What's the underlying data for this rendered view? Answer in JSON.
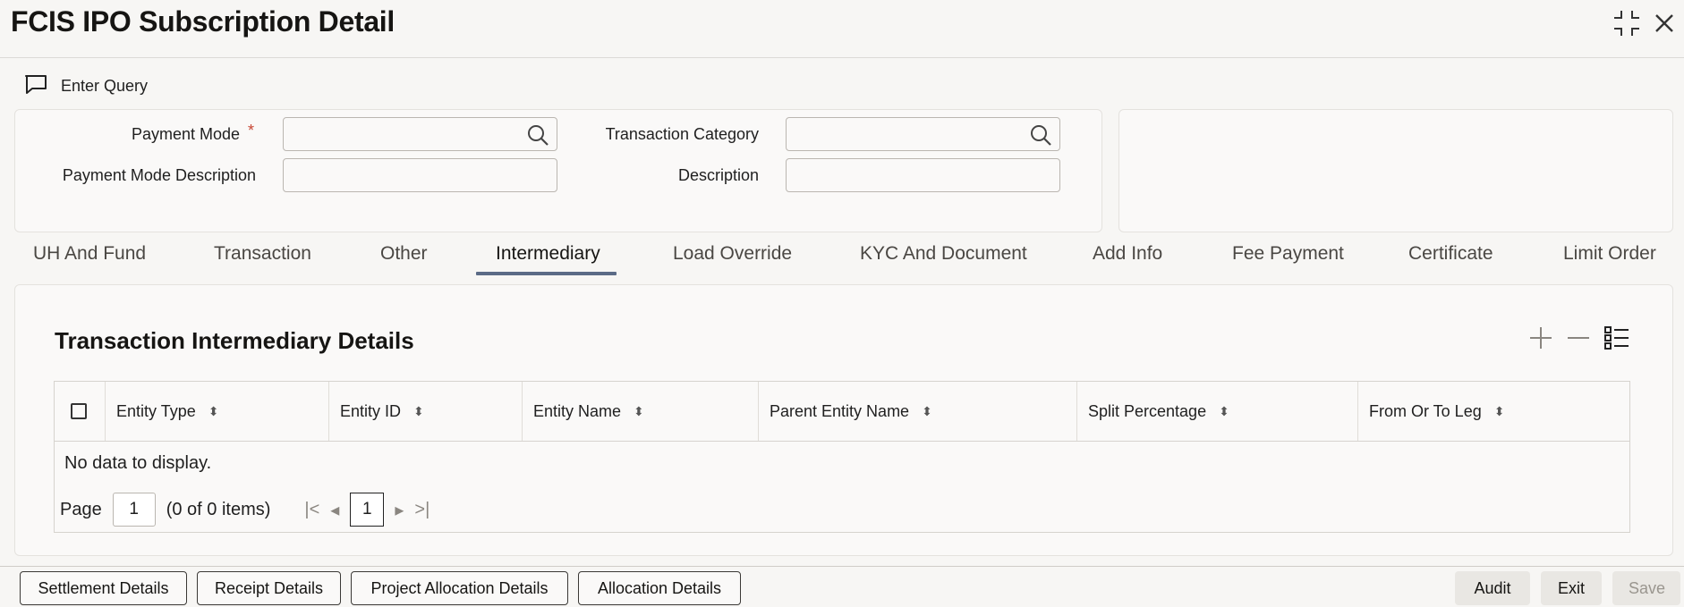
{
  "window": {
    "title": "FCIS IPO Subscription Detail"
  },
  "toolbar": {
    "enter_query_label": "Enter Query",
    "icon": "comment-icon"
  },
  "form": {
    "payment_mode_label": "Payment Mode",
    "required_mark": "*",
    "payment_mode_value": "",
    "payment_mode_desc_label": "Payment Mode Description",
    "payment_mode_desc_value": "",
    "txn_category_label": "Transaction Category",
    "txn_category_value": "",
    "description_label": "Description",
    "description_value": ""
  },
  "tabs": [
    {
      "label": "UH And Fund"
    },
    {
      "label": "Transaction"
    },
    {
      "label": "Other"
    },
    {
      "label": "Intermediary",
      "active": true
    },
    {
      "label": "Load Override"
    },
    {
      "label": "KYC And Document"
    },
    {
      "label": "Add Info"
    },
    {
      "label": "Fee Payment"
    },
    {
      "label": "Certificate"
    },
    {
      "label": "Limit Order"
    }
  ],
  "section": {
    "title": "Transaction Intermediary Details",
    "columns": [
      "Entity Type",
      "Entity ID",
      "Entity Name",
      "Parent Entity Name",
      "Split Percentage",
      "From Or To Leg"
    ],
    "empty_text": "No data to display.",
    "pager": {
      "page_label": "Page",
      "page_value": "1",
      "summary": "(0 of 0 items)",
      "current_page": "1"
    }
  },
  "footer": {
    "buttons": [
      "Settlement Details",
      "Receipt Details",
      "Project Allocation Details",
      "Allocation Details"
    ],
    "audit_label": "Audit",
    "exit_label": "Exit",
    "save_label": "Save"
  }
}
